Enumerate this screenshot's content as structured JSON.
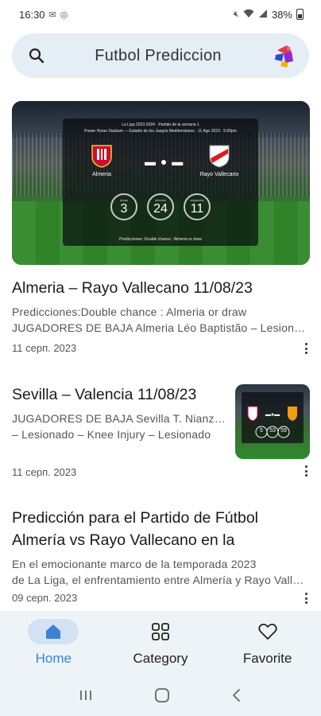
{
  "status_bar": {
    "time": "16:30",
    "battery": "38%"
  },
  "search": {
    "title": "Futbol Prediccion"
  },
  "hero": {
    "header_line1": "La Liga 2023-2024 · Partido de la semana 1",
    "header_line2": "Power Horse Stadium — Estadio de los Juegos Mediterráneos · 11 Ago 2023 · 5:00pm",
    "home_team": "Almeria",
    "away_team": "Rayo Vallecano",
    "timers": [
      {
        "label": "horas",
        "value": "3"
      },
      {
        "label": "minutos",
        "value": "24"
      },
      {
        "label": "segundos",
        "value": "11"
      }
    ],
    "prediction_line": "Predicciones: Double chance : Almeria or draw"
  },
  "articles": [
    {
      "title": "Almeria – Rayo Vallecano 11/08/23",
      "excerpt_line1": "Predicciones:Double chance : Almeria or draw",
      "excerpt_line2": "JUGADORES DE BAJA Almeria Léo Baptistão – Lesionado",
      "date": "11 серп. 2023"
    },
    {
      "title": "Sevilla – Valencia 11/08/23",
      "excerpt_line1": "JUGADORES DE BAJA Sevilla T. Nianzou",
      "excerpt_line2": "– Lesionado – Knee Injury – Lesionado",
      "date": "11 серп. 2023",
      "thumb_timers": [
        "5",
        "53",
        "59"
      ]
    },
    {
      "title_line1": "Predicción para el Partido de Fútbol",
      "title_line2": "Almería vs Rayo Vallecano en la",
      "excerpt_line1": "En el emocionante marco de la temporada 2023",
      "excerpt_line2": "de La Liga, el enfrentamiento entre Almería y Rayo Vallecano",
      "date": "09 серп. 2023"
    }
  ],
  "bottom_nav": [
    {
      "label": "Home",
      "icon": "home-icon",
      "active": true
    },
    {
      "label": "Category",
      "icon": "grid-icon",
      "active": false
    },
    {
      "label": "Favorite",
      "icon": "heart-icon",
      "active": false
    }
  ],
  "colors": {
    "accent": "#3b82d6",
    "nav_bg": "#eef3f8",
    "search_bg": "#e6eef5"
  }
}
